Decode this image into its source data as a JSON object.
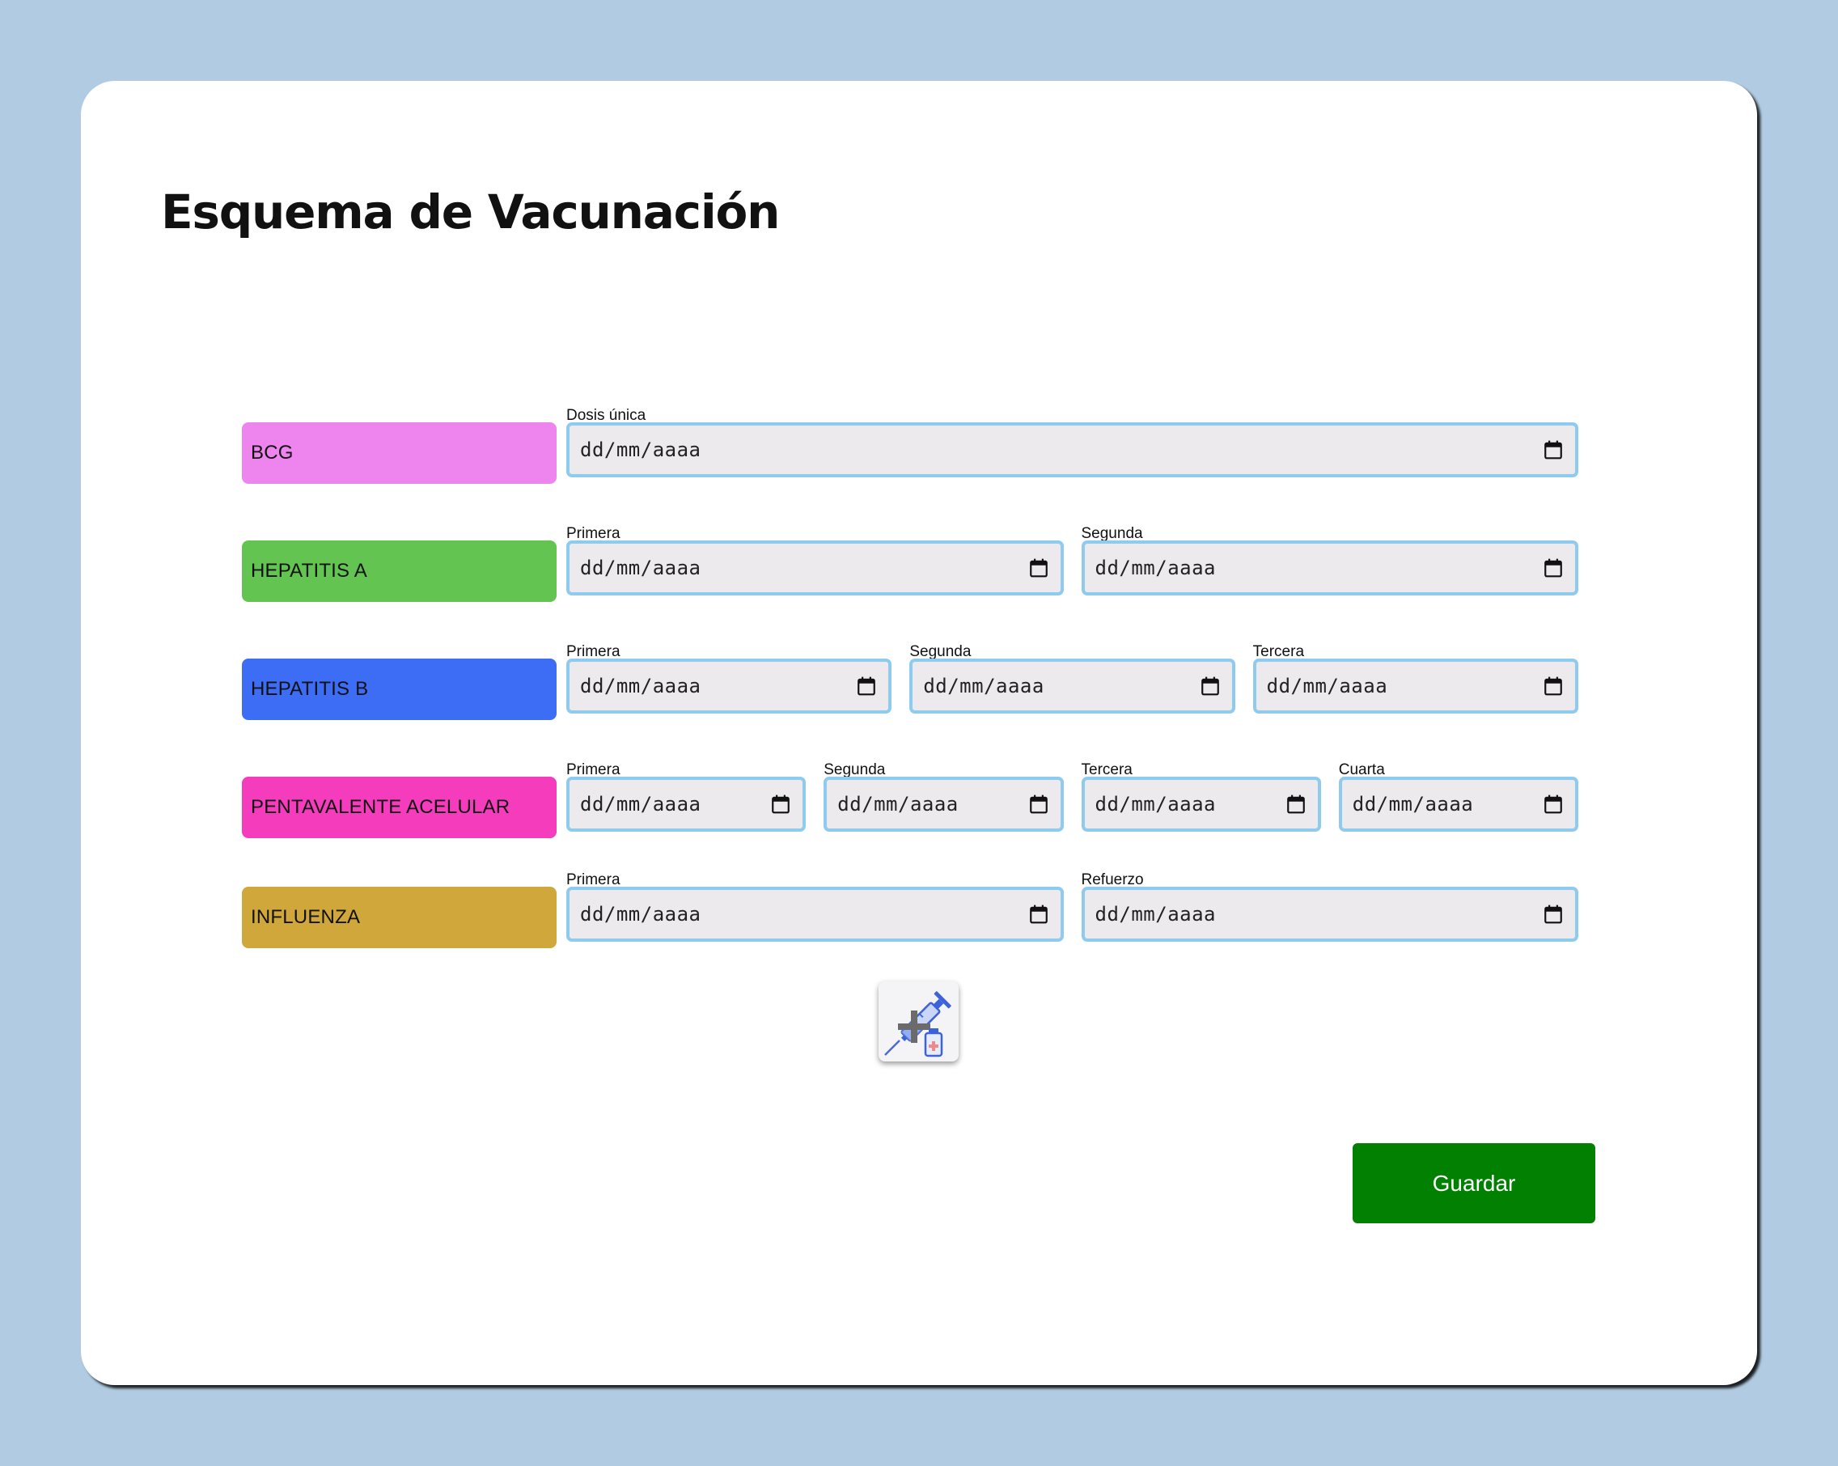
{
  "page": {
    "title": "Esquema de Vacunación"
  },
  "date_placeholder": "dd/mm/aaaa",
  "vaccines": [
    {
      "name": "BCG",
      "color": "#ee84ee",
      "doses": [
        {
          "label": "Dosis única",
          "value": "dd/mm/aaaa"
        }
      ]
    },
    {
      "name": "HEPATITIS A",
      "color": "#63c452",
      "doses": [
        {
          "label": "Primera",
          "value": "dd/mm/aaaa"
        },
        {
          "label": "Segunda",
          "value": "dd/mm/aaaa"
        }
      ]
    },
    {
      "name": "HEPATITIS B",
      "color": "#3d6cf5",
      "doses": [
        {
          "label": "Primera",
          "value": "dd/mm/aaaa"
        },
        {
          "label": "Segunda",
          "value": "dd/mm/aaaa"
        },
        {
          "label": "Tercera",
          "value": "dd/mm/aaaa"
        }
      ]
    },
    {
      "name": "PENTAVALENTE ACELULAR",
      "color": "#f53cbd",
      "doses": [
        {
          "label": "Primera",
          "value": "dd/mm/aaaa"
        },
        {
          "label": "Segunda",
          "value": "dd/mm/aaaa"
        },
        {
          "label": "Tercera",
          "value": "dd/mm/aaaa"
        },
        {
          "label": "Cuarta",
          "value": "dd/mm/aaaa"
        }
      ]
    },
    {
      "name": "INFLUENZA",
      "color": "#d0a73b",
      "doses": [
        {
          "label": "Primera",
          "value": "dd/mm/aaaa"
        },
        {
          "label": "Refuerzo",
          "value": "dd/mm/aaaa"
        }
      ]
    }
  ],
  "actions": {
    "add_vaccine_icon": "syringe-add-icon",
    "save_label": "Guardar"
  },
  "colors": {
    "background": "#b1cce2",
    "input_border": "#8fcaef",
    "input_background": "#eceaed",
    "save_button": "#018001"
  }
}
